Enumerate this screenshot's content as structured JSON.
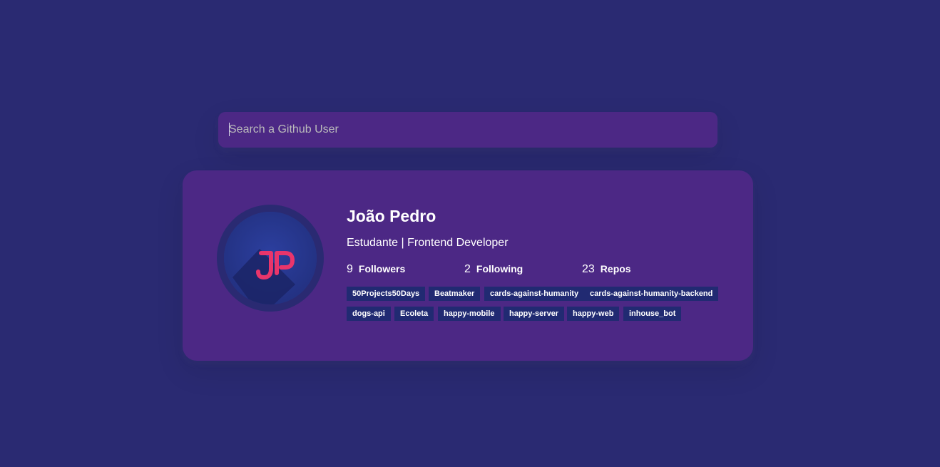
{
  "search": {
    "placeholder": "Search a Github User",
    "value": ""
  },
  "user": {
    "name": "João Pedro",
    "bio": "Estudante | Frontend Developer",
    "avatar_initials": "JP",
    "stats": [
      {
        "count": "9",
        "label": "Followers"
      },
      {
        "count": "2",
        "label": "Following"
      },
      {
        "count": "23",
        "label": "Repos"
      }
    ],
    "repos": [
      "50Projects50Days",
      "Beatmaker",
      "cards-against-humanity",
      "cards-against-humanity-backend",
      "dogs-api",
      "Ecoleta",
      "happy-mobile",
      "happy-server",
      "happy-web",
      "inhouse_bot"
    ]
  },
  "colors": {
    "background": "#2a2a72",
    "card": "#4c2885",
    "repo_tag": "#212a72",
    "avatar_bg": "#283593",
    "avatar_glyph": "#e9356b"
  }
}
